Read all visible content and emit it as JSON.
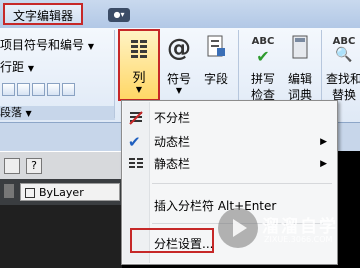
{
  "titlebar": {
    "editor_tab": "文字编辑器"
  },
  "ribbon": {
    "numbering_label": "项目符号和编号",
    "spacing_label": "行距",
    "paragraph_group": "段落",
    "columns_label": "列",
    "symbol_label": "符号",
    "field_label": "字段",
    "spellcheck_l1": "拼写",
    "spellcheck_l2": "检查",
    "dict_l1": "编辑",
    "dict_l2": "词典",
    "find_l1": "查找和",
    "find_l2": "替换"
  },
  "toolbar": {
    "layer_value": "ByLayer"
  },
  "menu": {
    "items": [
      {
        "label": "不分栏"
      },
      {
        "label": "动态栏"
      },
      {
        "label": "静态栏"
      },
      {
        "label": "插入分栏符 Alt+Enter"
      },
      {
        "label": "分栏设置..."
      }
    ]
  },
  "watermark": {
    "title": "溜溜自学",
    "url": "ZIXUE.3066.COM"
  },
  "colors": {
    "highlight_border": "#c62828",
    "checkmark": "#1f5fbf"
  }
}
